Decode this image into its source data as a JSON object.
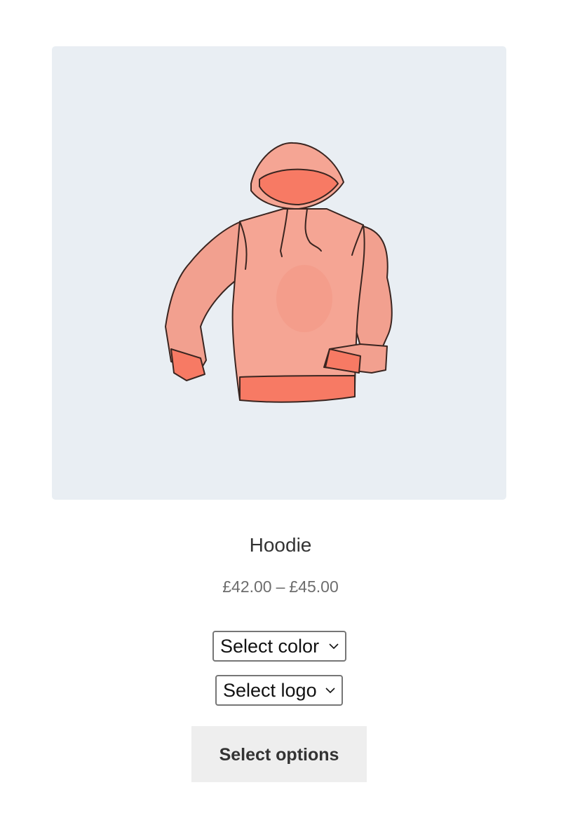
{
  "product": {
    "title": "Hoodie",
    "price_min": "£42.00",
    "price_sep": "–",
    "price_max": "£45.00",
    "image_icon": "hoodie-illustration",
    "colors": {
      "image_bg": "#e9eef3",
      "hoodie_fill": "#f5a594",
      "hoodie_band": "#f77a64",
      "outline": "#3a2520",
      "button_bg": "#eeeeee"
    }
  },
  "variations": {
    "color_select": "Select color",
    "logo_select": "Select logo"
  },
  "actions": {
    "select_options": "Select options"
  }
}
